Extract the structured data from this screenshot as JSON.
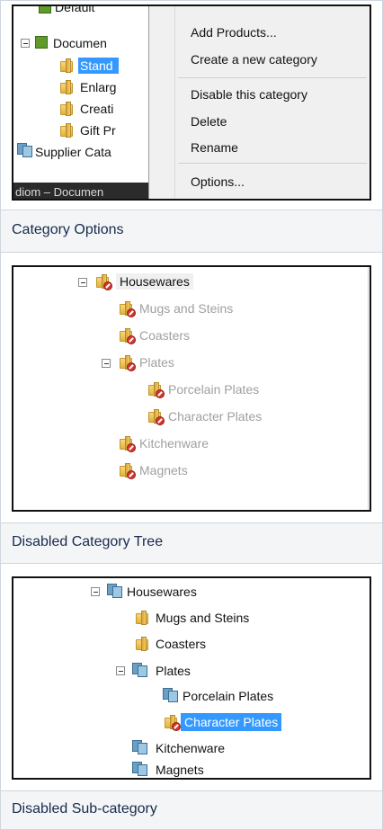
{
  "panel1": {
    "tree_items": [
      "Default",
      "Documen",
      "Stand",
      "Enlarg",
      "Creati",
      "Gift Pr",
      "Supplier Cata"
    ],
    "status_bar": "diom – Documen",
    "menu_items": [
      "Add Products...",
      "Create a new category",
      "Disable this category",
      "Delete",
      "Rename",
      "Options..."
    ],
    "caption": "Category Options"
  },
  "panel2": {
    "root": "Housewares",
    "items": [
      "Mugs and Steins",
      "Coasters",
      "Plates",
      "Porcelain Plates",
      "Character Plates",
      "Kitchenware",
      "Magnets"
    ],
    "caption": "Disabled Category Tree"
  },
  "panel3": {
    "root": "Housewares",
    "items": [
      "Mugs and Steins",
      "Coasters",
      "Plates",
      "Porcelain Plates",
      "Character Plates",
      "Kitchenware",
      "Magnets"
    ],
    "caption": "Disabled Sub-category"
  },
  "colors": {
    "selection": "#3399ff",
    "disabled_text": "#a0a0a0",
    "caption_bg": "#f4f5f7",
    "caption_text": "#172b4d"
  }
}
